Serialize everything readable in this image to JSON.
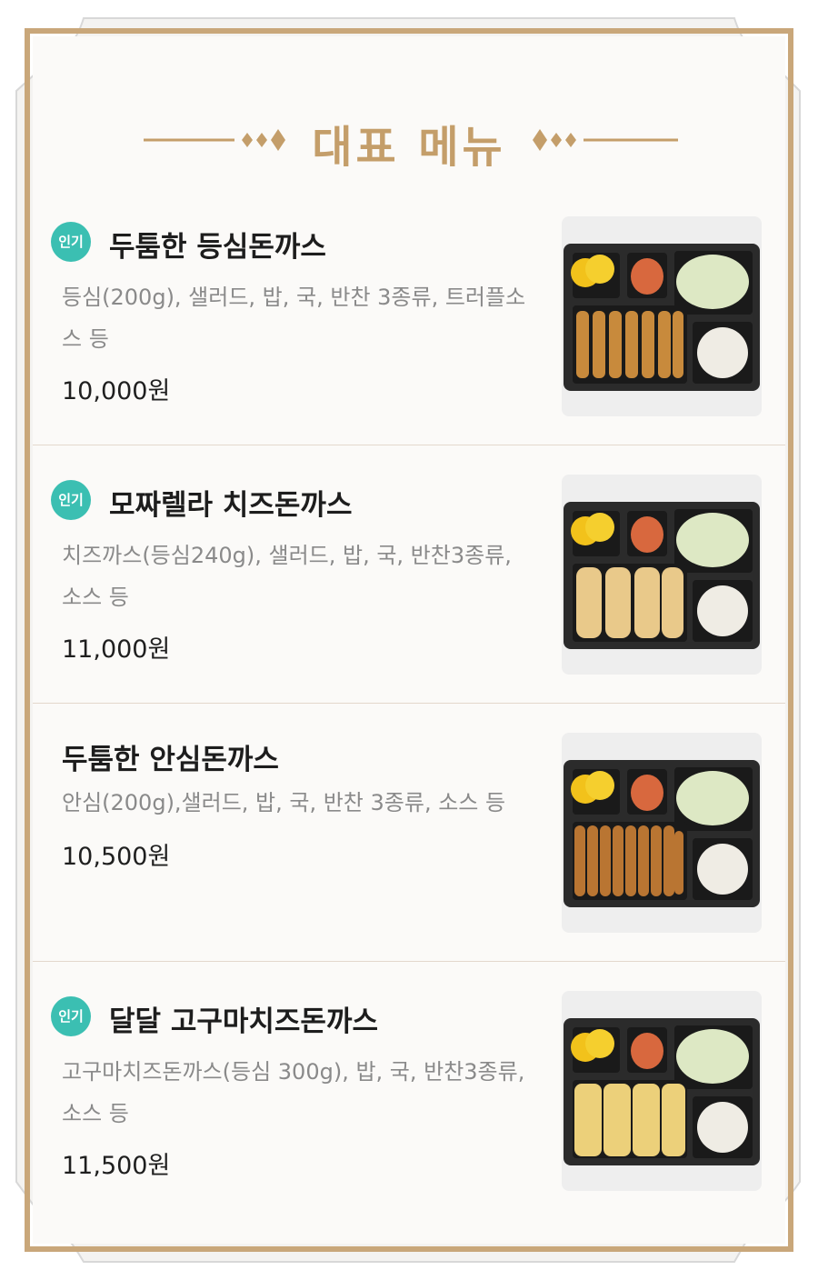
{
  "header": {
    "title": "대표 메뉴"
  },
  "menu_items": [
    {
      "badge": "인기",
      "name": "두툼한 등심돈까스",
      "desc_lines": [
        "등심(200g), 샐러드, 밥, 국, 반찬 3종류, 트러플소",
        "스 등"
      ],
      "price": "10,000원",
      "photo": "dosirak-pork-cutlet-sliced-icon"
    },
    {
      "badge": "인기",
      "name": "모짜렐라 치즈돈까스",
      "desc_lines": [
        "치즈까스(등심240g), 샐러드, 밥, 국, 반찬3종류,",
        "소스 등"
      ],
      "price": "11,000원",
      "photo": "dosirak-cheese-cutlet-icon"
    },
    {
      "badge": "",
      "name": "두툼한 안심돈까스",
      "desc_lines": [
        "안심(200g),샐러드, 밥, 국, 반찬 3종류, 소스 등"
      ],
      "price": "10,500원",
      "photo": "dosirak-tenderloin-cutlet-icon"
    },
    {
      "badge": "인기",
      "name": "달달 고구마치즈돈까스",
      "desc_lines": [
        "고구마치즈돈까스(등심 300g), 밥, 국, 반찬3종류,",
        "소스 등"
      ],
      "price": "11,500원",
      "photo": "dosirak-sweet-potato-cheese-cutlet-icon"
    }
  ],
  "colors": {
    "accent_gold": "#c49e6a",
    "badge_teal": "#3bbfb2",
    "frame_border": "#c9a77a"
  }
}
